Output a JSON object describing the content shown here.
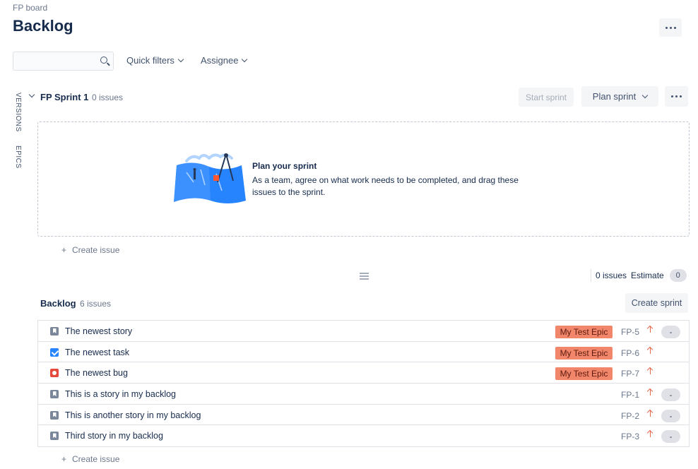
{
  "header": {
    "board_name": "FP board",
    "title": "Backlog"
  },
  "filters": {
    "search_placeholder": "",
    "quick_filters_label": "Quick filters",
    "assignee_label": "Assignee"
  },
  "side_tabs": {
    "versions": "VERSIONS",
    "epics": "EPICS"
  },
  "sprint": {
    "name": "FP Sprint 1",
    "count": "0 issues",
    "start_label": "Start sprint",
    "plan_label": "Plan sprint",
    "empty_title": "Plan your sprint",
    "empty_text": "As a team, agree on what work needs to be completed, and drag these issues to the sprint.",
    "create_issue_label": "Create issue",
    "totals_label": "0 issues",
    "estimate_label": "Estimate",
    "estimate_value": "0"
  },
  "backlog": {
    "name": "Backlog",
    "count": "6 issues",
    "create_sprint_label": "Create sprint",
    "create_issue_label": "Create issue",
    "issues": [
      {
        "type": "story",
        "summary": "The newest story",
        "epic": "My Test Epic",
        "key": "FP-5",
        "priority": "high",
        "estimate": "-"
      },
      {
        "type": "task",
        "summary": "The newest task",
        "epic": "My Test Epic",
        "key": "FP-6",
        "priority": "high",
        "estimate": ""
      },
      {
        "type": "bug",
        "summary": "The newest bug",
        "epic": "My Test Epic",
        "key": "FP-7",
        "priority": "high",
        "estimate": ""
      },
      {
        "type": "story",
        "summary": "This is a story in my backlog",
        "epic": "",
        "key": "FP-1",
        "priority": "high",
        "estimate": "-"
      },
      {
        "type": "story",
        "summary": "This is another story in my backlog",
        "epic": "",
        "key": "FP-2",
        "priority": "high",
        "estimate": "-"
      },
      {
        "type": "story",
        "summary": "Third story in my backlog",
        "epic": "",
        "key": "FP-3",
        "priority": "high",
        "estimate": "-"
      }
    ]
  },
  "colors": {
    "epic_lozenge": "#f1866b",
    "priority_high": "#e5684a",
    "story": "#7a869a",
    "task": "#2684ff",
    "bug": "#e5493a"
  },
  "icons": {
    "search": "search-icon",
    "more": "more-icon",
    "chevron": "chevron-down-icon",
    "priority": "arrow-up-icon",
    "plus": "plus-icon",
    "resize": "drag-handle-icon"
  }
}
